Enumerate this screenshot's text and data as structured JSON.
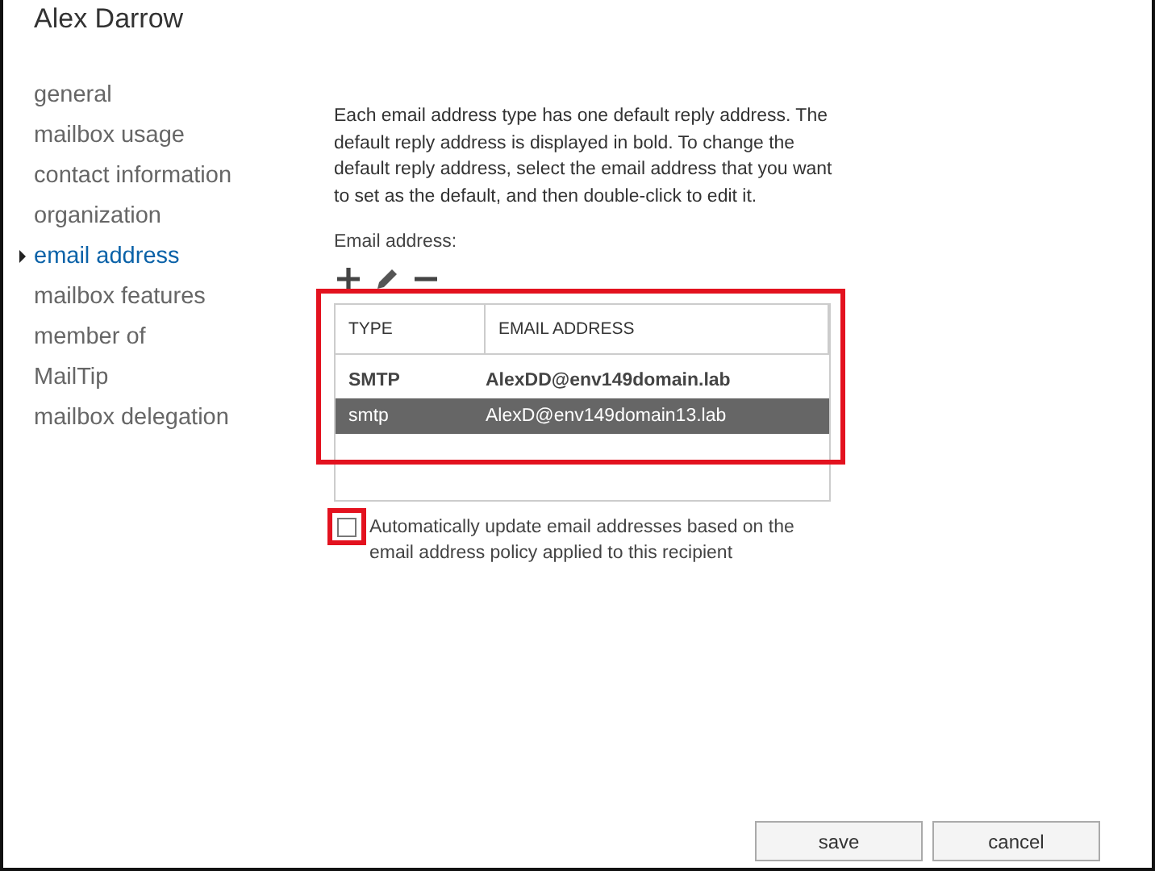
{
  "window": {
    "title": "Alex Darrow"
  },
  "sidebar": {
    "items": [
      {
        "label": "general",
        "selected": false
      },
      {
        "label": "mailbox usage",
        "selected": false
      },
      {
        "label": "contact information",
        "selected": false
      },
      {
        "label": "organization",
        "selected": false
      },
      {
        "label": "email address",
        "selected": true
      },
      {
        "label": "mailbox features",
        "selected": false
      },
      {
        "label": "member of",
        "selected": false
      },
      {
        "label": "MailTip",
        "selected": false
      },
      {
        "label": "mailbox delegation",
        "selected": false
      }
    ]
  },
  "description": "Each email address type has one default reply address. The default reply address is displayed in bold. To change the default reply address, select the email address that you want to set as the default, and then double-click to edit it.",
  "email_label": "Email address:",
  "table": {
    "highlighted": true,
    "columns": [
      "TYPE",
      "EMAIL ADDRESS"
    ],
    "rows": [
      {
        "type": "SMTP",
        "address": "AlexDD@env149domain.lab",
        "default": true,
        "selected": false
      },
      {
        "type": "smtp",
        "address": "AlexD@env149domain13.lab",
        "default": false,
        "selected": true
      }
    ]
  },
  "auto_update": {
    "label": "Automatically update email addresses based on the email address policy applied to this recipient",
    "checked": false,
    "highlighted": true
  },
  "buttons": [
    "save",
    "cancel"
  ]
}
